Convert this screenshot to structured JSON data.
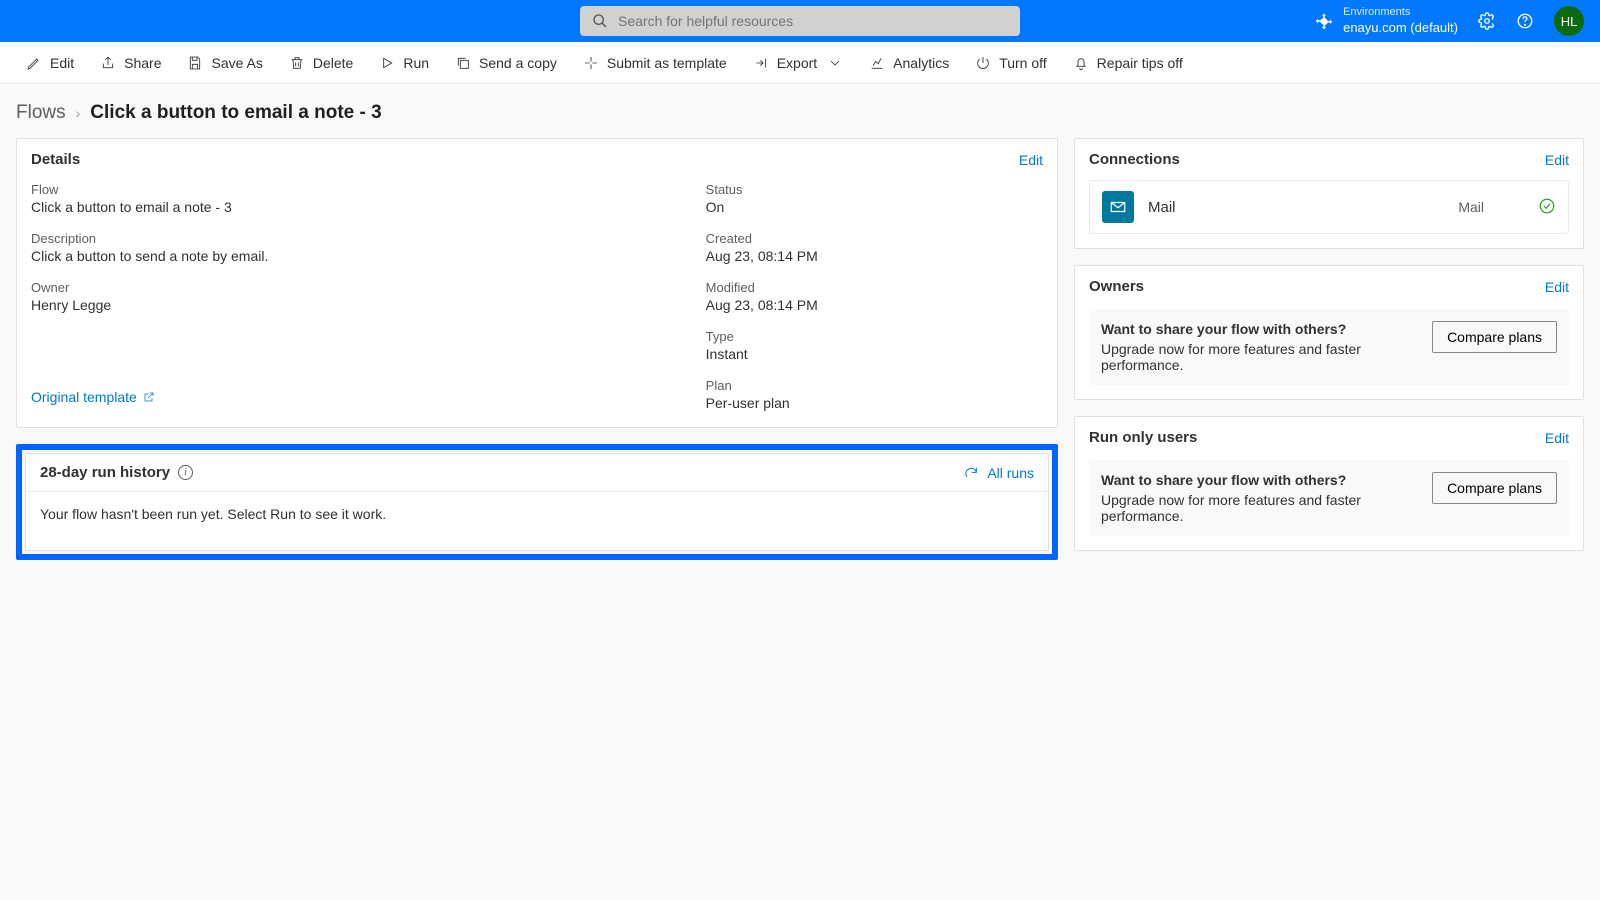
{
  "header": {
    "search_placeholder": "Search for helpful resources",
    "env_label": "Environments",
    "env_value": "enayu.com (default)",
    "avatar_initials": "HL"
  },
  "toolbar": {
    "edit": "Edit",
    "share": "Share",
    "save_as": "Save As",
    "delete": "Delete",
    "run": "Run",
    "send_copy": "Send a copy",
    "submit_template": "Submit as template",
    "export": "Export",
    "analytics": "Analytics",
    "turn_off": "Turn off",
    "repair_tips_off": "Repair tips off"
  },
  "breadcrumb": {
    "root": "Flows",
    "current": "Click a button to email a note - 3"
  },
  "details_card": {
    "title": "Details",
    "edit_link": "Edit",
    "fields": {
      "flow": {
        "label": "Flow",
        "value": "Click a button to email a note - 3"
      },
      "description": {
        "label": "Description",
        "value": "Click a button to send a note by email."
      },
      "owner": {
        "label": "Owner",
        "value": "Henry Legge"
      },
      "status": {
        "label": "Status",
        "value": "On"
      },
      "created": {
        "label": "Created",
        "value": "Aug 23, 08:14 PM"
      },
      "modified": {
        "label": "Modified",
        "value": "Aug 23, 08:14 PM"
      },
      "type": {
        "label": "Type",
        "value": "Instant"
      },
      "plan": {
        "label": "Plan",
        "value": "Per-user plan"
      }
    },
    "original_template": "Original template"
  },
  "run_history": {
    "title": "28-day run history",
    "all_runs": "All runs",
    "empty_text": "Your flow hasn't been run yet. Select Run to see it work."
  },
  "connections_card": {
    "title": "Connections",
    "edit_link": "Edit",
    "item": {
      "name": "Mail",
      "type": "Mail"
    }
  },
  "owners_card": {
    "title": "Owners",
    "edit_link": "Edit"
  },
  "run_only_card": {
    "title": "Run only users",
    "edit_link": "Edit"
  },
  "upsell": {
    "heading": "Want to share your flow with others?",
    "sub": "Upgrade now for more features and faster performance.",
    "button": "Compare plans"
  }
}
